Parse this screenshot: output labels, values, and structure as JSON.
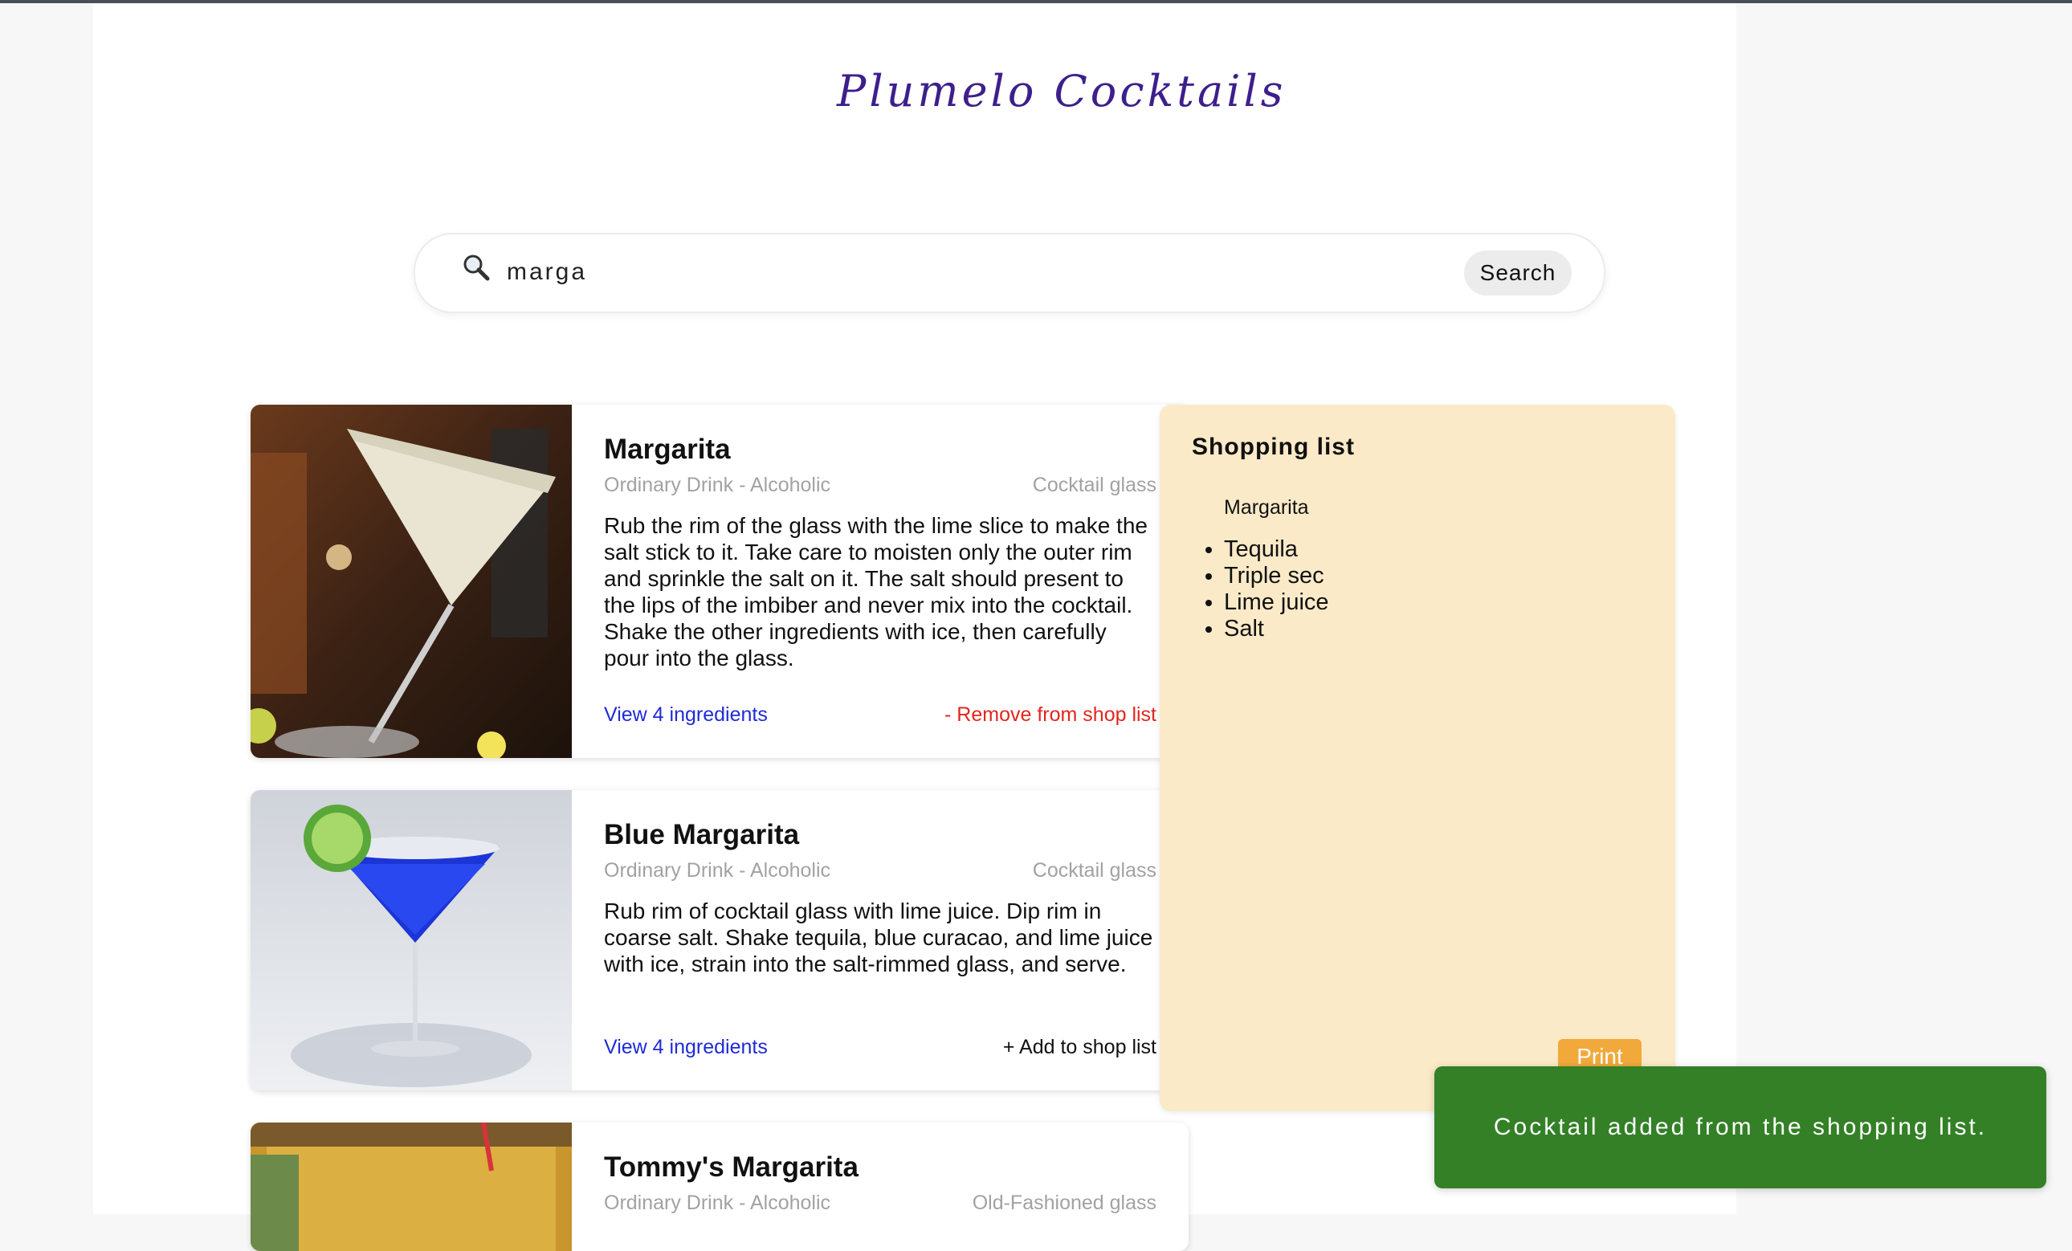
{
  "app": {
    "title": "Plumelo Cocktails"
  },
  "search": {
    "value": "marga",
    "button_label": "Search",
    "icon": "magnifier-icon"
  },
  "results": [
    {
      "name": "Margarita",
      "category": "Ordinary Drink - Alcoholic",
      "glass": "Cocktail glass",
      "instructions": "Rub the rim of the glass with the lime slice to make the salt stick to it. Take care to moisten only the outer rim and sprinkle the salt on it. The salt should present to the lips of the imbiber and never mix into the cocktail. Shake the other ingredients with ice, then carefully pour into the glass.",
      "view_label": "View 4 ingredients",
      "shop_label": "- Remove from shop list",
      "in_shop_list": true
    },
    {
      "name": "Blue Margarita",
      "category": "Ordinary Drink - Alcoholic",
      "glass": "Cocktail glass",
      "instructions": "Rub rim of cocktail glass with lime juice. Dip rim in coarse salt. Shake tequila, blue curacao, and lime juice with ice, strain into the salt-rimmed glass, and serve.",
      "view_label": "View 4 ingredients",
      "shop_label": "+ Add to shop list",
      "in_shop_list": false
    },
    {
      "name": "Tommy's Margarita",
      "category": "Ordinary Drink - Alcoholic",
      "glass": "Old-Fashioned glass"
    }
  ],
  "shopping_list": {
    "heading": "Shopping list",
    "drinks": [
      {
        "name": "Margarita",
        "ingredients": [
          "Tequila",
          "Triple sec",
          "Lime juice",
          "Salt"
        ]
      }
    ],
    "print_label": "Print"
  },
  "toast": {
    "message": "Cocktail added from the shopping list."
  },
  "colors": {
    "brand": "#3d1f8c",
    "link": "#1f2bd6",
    "remove": "#e2261e",
    "panel_bg": "#fbeac8",
    "print_button": "#f2a93b",
    "toast_bg": "#338026"
  }
}
